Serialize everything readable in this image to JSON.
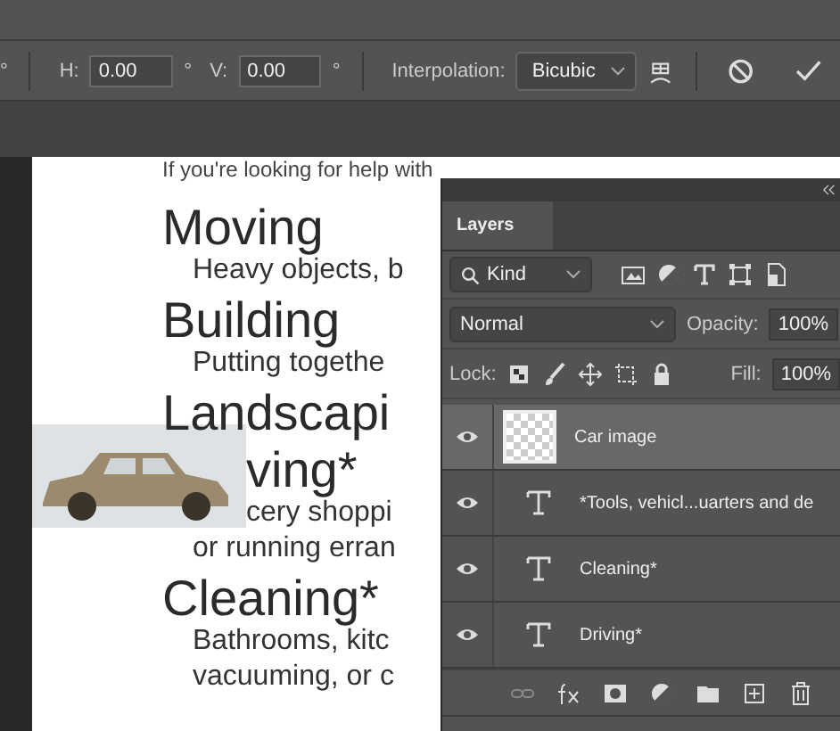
{
  "options_bar": {
    "leading_unit": "°",
    "fields": [
      {
        "label": "H:",
        "value": "0.00",
        "unit": "°"
      },
      {
        "label": "V:",
        "value": "0.00",
        "unit": "°"
      }
    ],
    "interpolation": {
      "label": "Interpolation:",
      "value": "Bicubic"
    }
  },
  "document": {
    "intro": "If you're looking for help with",
    "sections": [
      {
        "kind": "plain",
        "heading": "Moving",
        "lines": [
          "Heavy objects, b"
        ]
      },
      {
        "kind": "plain",
        "heading": "Building",
        "lines": [
          "Putting togethe"
        ]
      },
      {
        "kind": "plain",
        "heading": "Landscapi"
      },
      {
        "kind": "beside-photo",
        "heading": "ving*",
        "lines": [
          "cery shoppi",
          "or running erran"
        ]
      },
      {
        "kind": "plain",
        "heading": "Cleaning*",
        "lines": [
          "Bathrooms, kitc",
          "vacuuming, or c"
        ]
      }
    ]
  },
  "layers_panel": {
    "tab": "Layers",
    "filter": "Kind",
    "blend_mode": "Normal",
    "opacity_label": "Opacity:",
    "opacity": "100%",
    "lock_label": "Lock:",
    "fill_label": "Fill:",
    "fill": "100%",
    "layers": [
      {
        "name": "Car image",
        "kind": "image",
        "selected": true,
        "visible": true
      },
      {
        "name": "*Tools, vehicl...uarters and de",
        "kind": "text",
        "selected": false,
        "visible": true
      },
      {
        "name": "Cleaning*",
        "kind": "text",
        "selected": false,
        "visible": true
      },
      {
        "name": "Driving*",
        "kind": "text",
        "selected": false,
        "visible": true
      }
    ]
  }
}
